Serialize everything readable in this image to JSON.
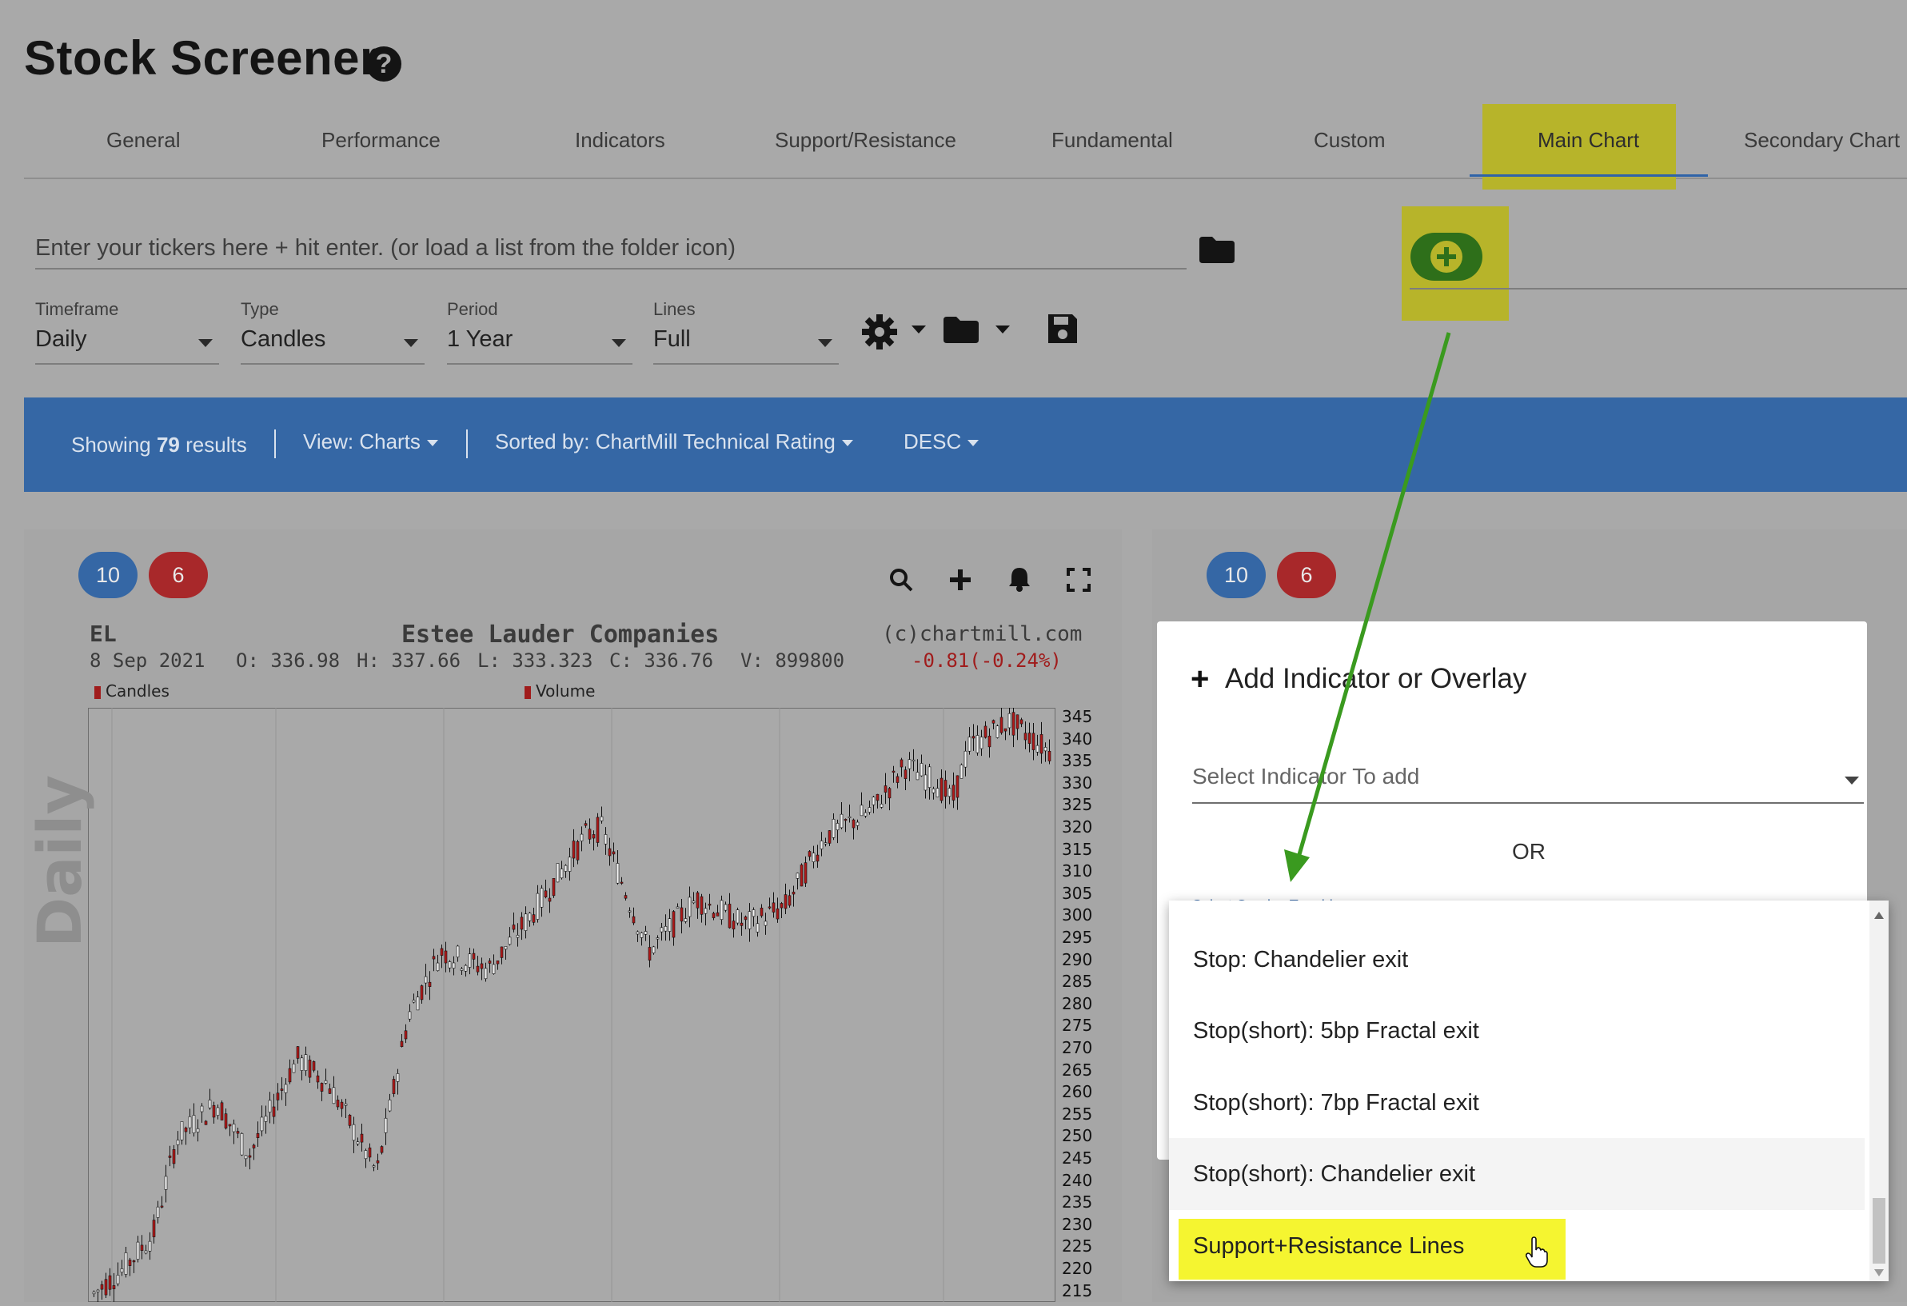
{
  "page": {
    "title": "Stock Screener",
    "help_glyph": "?"
  },
  "tabs": [
    {
      "label": "General"
    },
    {
      "label": "Performance"
    },
    {
      "label": "Indicators"
    },
    {
      "label": "Support/Resistance"
    },
    {
      "label": "Fundamental"
    },
    {
      "label": "Custom"
    },
    {
      "label": "Main Chart",
      "active": true
    },
    {
      "label": "Secondary Chart"
    }
  ],
  "ticker": {
    "placeholder": "Enter your tickers here + hit enter. (or load a list from the folder icon)"
  },
  "selects": [
    {
      "label": "Timeframe",
      "value": "Daily"
    },
    {
      "label": "Type",
      "value": "Candles"
    },
    {
      "label": "Period",
      "value": "1 Year"
    },
    {
      "label": "Lines",
      "value": "Full"
    }
  ],
  "icons": [
    "gear-icon",
    "folder-icon",
    "save-icon",
    "add-circle-icon",
    "search-icon",
    "plus-icon",
    "bell-icon",
    "fullscreen-icon"
  ],
  "results_bar": {
    "showing_prefix": "Showing",
    "count": "79",
    "showing_suffix": "results",
    "view": "View: Charts",
    "sorted": "Sorted by: ChartMill Technical Rating",
    "order": "DESC"
  },
  "card_left": {
    "badge_blue": "10",
    "badge_red": "6",
    "ticker": "EL",
    "company": "Estee Lauder Companies",
    "source": "(c)chartmill.com",
    "date": "8 Sep 2021",
    "open": "O: 336.98",
    "high": "H: 337.66",
    "low": "L: 333.323",
    "close": "C: 336.76",
    "volume": "V: 899800",
    "change": "-0.81(-0.24%)",
    "legend_candles": "Candles",
    "legend_volume": "Volume",
    "watermark": "Daily",
    "y_ticks": [
      "345",
      "340",
      "335",
      "330",
      "325",
      "320",
      "315",
      "310",
      "305",
      "300",
      "295",
      "290",
      "285",
      "280",
      "275",
      "270",
      "265",
      "260",
      "255",
      "250",
      "245",
      "240",
      "235",
      "230",
      "225",
      "220",
      "215"
    ]
  },
  "card_right": {
    "badge_blue": "10",
    "badge_red": "6"
  },
  "modal": {
    "plus": "+",
    "title": "Add Indicator or Overlay",
    "indicator_placeholder": "Select Indicator To add",
    "or": "OR",
    "overlay_label": "Select Overlay To add"
  },
  "overlay_options": [
    "Stop: Chandelier exit",
    "Stop(short): 5bp Fractal exit",
    "Stop(short): 7bp Fractal exit",
    "Stop(short): Chandelier exit",
    "Support+Resistance Lines"
  ],
  "colors": {
    "accent_blue": "#3567a5",
    "badge_red": "#a8282a",
    "highlight_yellow": "#f5f530",
    "arrow_green": "#3a9a1f"
  }
}
